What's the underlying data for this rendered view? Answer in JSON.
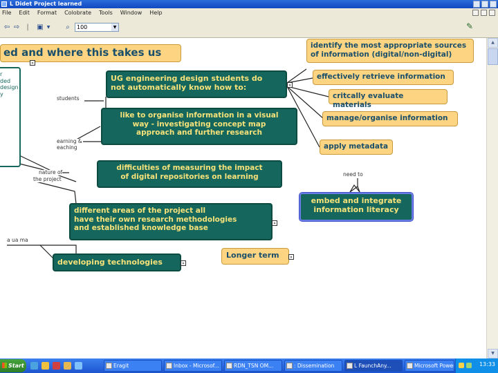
{
  "window": {
    "title": "L Didet Project learned"
  },
  "menu": [
    "File",
    "Edit",
    "Format",
    "Colobrate",
    "Tools",
    "Window",
    "Help"
  ],
  "toolbar": {
    "zoom_value": "100"
  },
  "map": {
    "header_node": "ed and where this takes us",
    "side_fragments": [
      "r",
      "ded",
      "design",
      "y"
    ],
    "ug_node": [
      "UG engineering design students do",
      "not automatically know how to:"
    ],
    "visual_node": [
      "like to organise information in a visual",
      "way - investigating concept map",
      "approach and further research"
    ],
    "measuring_node": [
      "difficulties of measuring the impact",
      "of digital repositories on learning"
    ],
    "methods_node": [
      "different areas of the project all",
      "have their own research methodologies",
      "and established knowledge base"
    ],
    "tech_node": "developing technologies",
    "longer_term_node": "Longer term",
    "sources_node": [
      "identify the most appropriate sources",
      "of information (digital/non-digital)"
    ],
    "retrieve_node": "effectively retrieve information",
    "evaluate_node": "critcally evaluate materials",
    "manage_node": "manage/organise information",
    "metadata_node": "apply metadata",
    "embed_node": [
      "embed and integrate",
      "information literacy"
    ],
    "labels": {
      "students": "students",
      "learning_teaching": [
        "earning &",
        "eaching"
      ],
      "nature": [
        "nature of",
        "the project"
      ],
      "academia": "a ua ma",
      "need_to": "need to"
    },
    "marker_glyph": "»"
  },
  "taskbar": {
    "start": "Start",
    "tasks": [
      {
        "label": "Eragit"
      },
      {
        "label": "Inbox - Microsof..."
      },
      {
        "label": "RDN_TSN OM..."
      },
      {
        "label": ": Dissemination"
      },
      {
        "label": "L FaunchAny...",
        "active": true
      },
      {
        "label": "Microsoft Power..."
      }
    ],
    "clock": "13:33"
  }
}
